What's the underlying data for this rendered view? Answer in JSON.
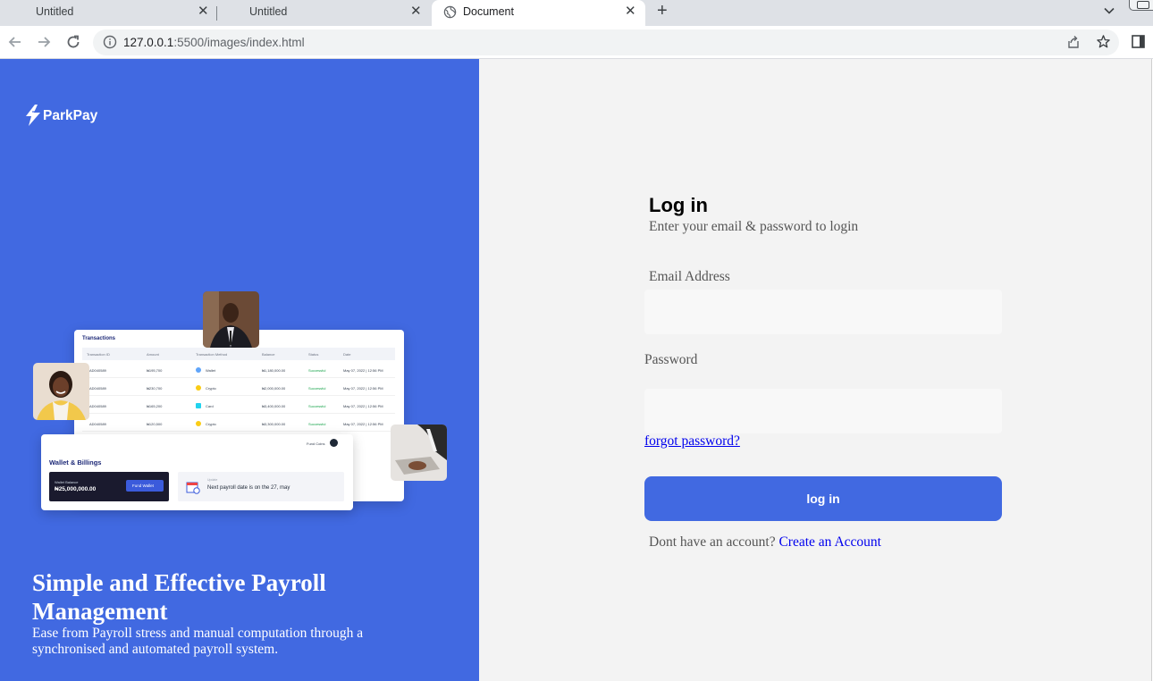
{
  "browser": {
    "tabs": [
      {
        "title": "Untitled",
        "active": false
      },
      {
        "title": "Untitled",
        "active": false
      },
      {
        "title": "Document",
        "active": true
      }
    ],
    "close_glyph": "✕",
    "new_tab_glyph": "+",
    "url_host": "127.0.0.1",
    "url_path": ":5500/images/index.html",
    "icons": [
      "back-arrow-icon",
      "forward-arrow-icon",
      "reload-icon",
      "info-icon",
      "share-icon",
      "star-icon",
      "side-panel-icon",
      "globe-icon",
      "chevron-down-icon"
    ]
  },
  "brand": {
    "name": "ParkPay",
    "accent": "#4169e1",
    "panel_bg": "#f3f3f3"
  },
  "hero": {
    "title": "Simple and Effective Payroll Management",
    "text": "Ease from Payroll stress and manual computation through a synchronised and automated payroll system."
  },
  "illustration": {
    "transactions_title": "Transactions",
    "columns": [
      "Transaction ID",
      "Amount",
      "Transaction Method",
      "Balance",
      "Status",
      "Date"
    ],
    "rows": [
      [
        "AD040589",
        "₦195,700",
        "Wallet",
        "₦1,180,000.00",
        "Successful",
        "May 07, 2022 | 12:56 PM"
      ],
      [
        "AD040589",
        "₦230,700",
        "Crypto",
        "₦2,000,000.00",
        "Successful",
        "May 07, 2022 | 12:56 PM"
      ],
      [
        "AD040589",
        "₦165,200",
        "Card",
        "₦3,400,000.00",
        "Successful",
        "May 07, 2022 | 12:56 PM"
      ],
      [
        "AD040589",
        "₦120,500",
        "Crypto",
        "₦3,300,000.00",
        "Successful",
        "May 07, 2022 | 12:56 PM"
      ]
    ],
    "wallet_title": "Wallet & Billings",
    "wallet_balance_label": "Wallet Balance",
    "wallet_balance": "₦25,000,000.00",
    "fund_wallet": "Fund Wallet",
    "fund_coins": "Fund Coins",
    "payroll_label": "Update",
    "payroll_text": "Next payroll date is on the 27, may"
  },
  "login": {
    "title": "Log in",
    "subtitle": "Enter your email & password to login",
    "email_label": "Email Address",
    "email_value": "",
    "password_label": "Password",
    "password_value": "",
    "forgot": "forgot password?",
    "button": "log in",
    "no_account": "Dont have an account?",
    "create_account": "Create an Account"
  }
}
